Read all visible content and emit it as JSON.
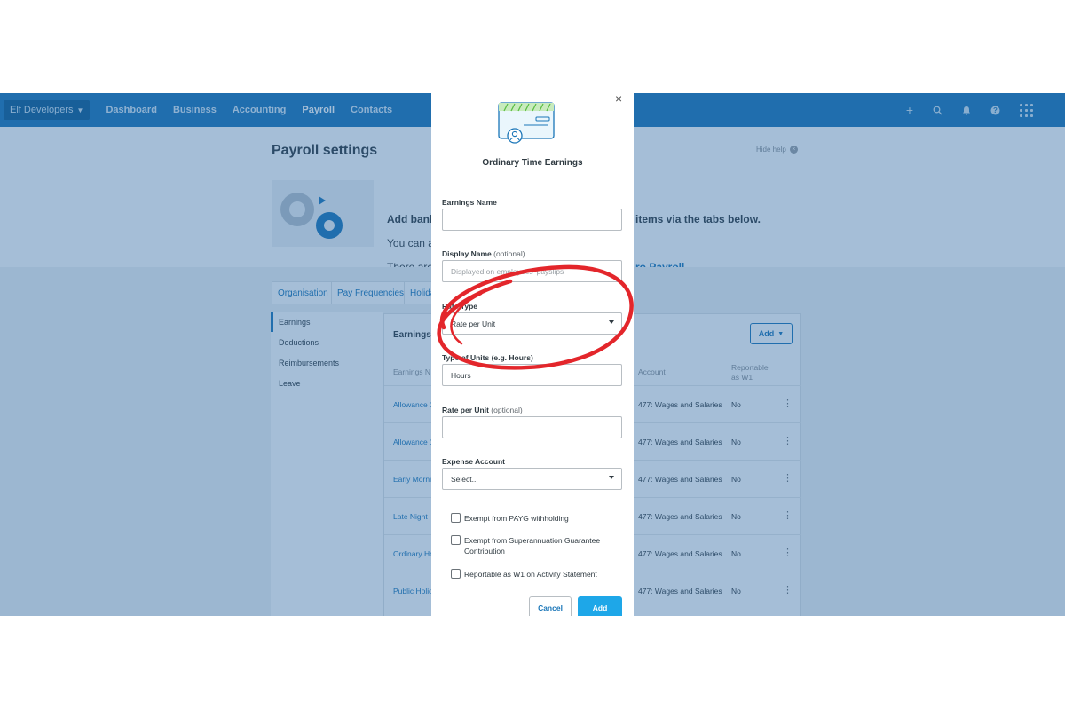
{
  "topnav": {
    "org_name": "Elf Developers",
    "links": [
      "Dashboard",
      "Business",
      "Accounting",
      "Payroll",
      "Contacts"
    ],
    "icons": [
      "plus-icon",
      "search-icon",
      "bell-icon",
      "help-icon",
      "apps-grid-icon"
    ]
  },
  "page": {
    "title": "Payroll settings",
    "hide_help": "Hide help",
    "help_line1": "Add bank",
    "help_line2": "You can a",
    "help_line3": "There are",
    "help_right1": "items via the tabs below.",
    "help_right2": "ro Payroll."
  },
  "tabs": [
    "Organisation",
    "Pay Frequencies",
    "Holida"
  ],
  "left_menu": [
    "Earnings",
    "Deductions",
    "Reimbursements",
    "Leave"
  ],
  "table": {
    "title": "Earnings",
    "add_label": "Add",
    "headers": {
      "name": "Earnings N",
      "account": "Account",
      "reportable": "Reportable as W1"
    },
    "rows": [
      {
        "name": "Allowance 1",
        "account": "477: Wages and Salaries",
        "reportable": "No"
      },
      {
        "name": "Allowance 1",
        "account": "477: Wages and Salaries",
        "reportable": "No"
      },
      {
        "name": "Early Mornin",
        "account": "477: Wages and Salaries",
        "reportable": "No"
      },
      {
        "name": "Late Night",
        "account": "477: Wages and Salaries",
        "reportable": "No"
      },
      {
        "name": "Ordinary Ho",
        "account": "477: Wages and Salaries",
        "reportable": "No"
      },
      {
        "name": "Public Holida",
        "account": "477: Wages and Salaries",
        "reportable": "No"
      }
    ]
  },
  "modal": {
    "close_glyph": "×",
    "title": "Ordinary Time Earnings",
    "earnings_name_label": "Earnings Name",
    "earnings_name_value": "",
    "display_name_label": "Display Name",
    "optional_text": "(optional)",
    "display_name_placeholder": "Displayed on employees' payslips",
    "rate_type_label": "Rate Type",
    "rate_type_value": "Rate per Unit",
    "units_type_label": "Type of Units (e.g. Hours)",
    "units_type_value": "Hours",
    "rate_per_unit_label": "Rate per Unit",
    "rate_per_unit_value": "",
    "expense_account_label": "Expense Account",
    "expense_account_value": "Select...",
    "checkboxes": [
      {
        "label": "Exempt from PAYG withholding",
        "checked": false
      },
      {
        "label": "Exempt from Superannuation Guarantee Contribution",
        "checked": false
      },
      {
        "label": "Reportable as W1 on Activity Statement",
        "checked": false
      }
    ],
    "cancel_label": "Cancel",
    "add_label": "Add"
  },
  "colors": {
    "nav_blue": "#1a76b8",
    "primary_button": "#1ea7e8",
    "annotation_red": "#e3262b"
  }
}
